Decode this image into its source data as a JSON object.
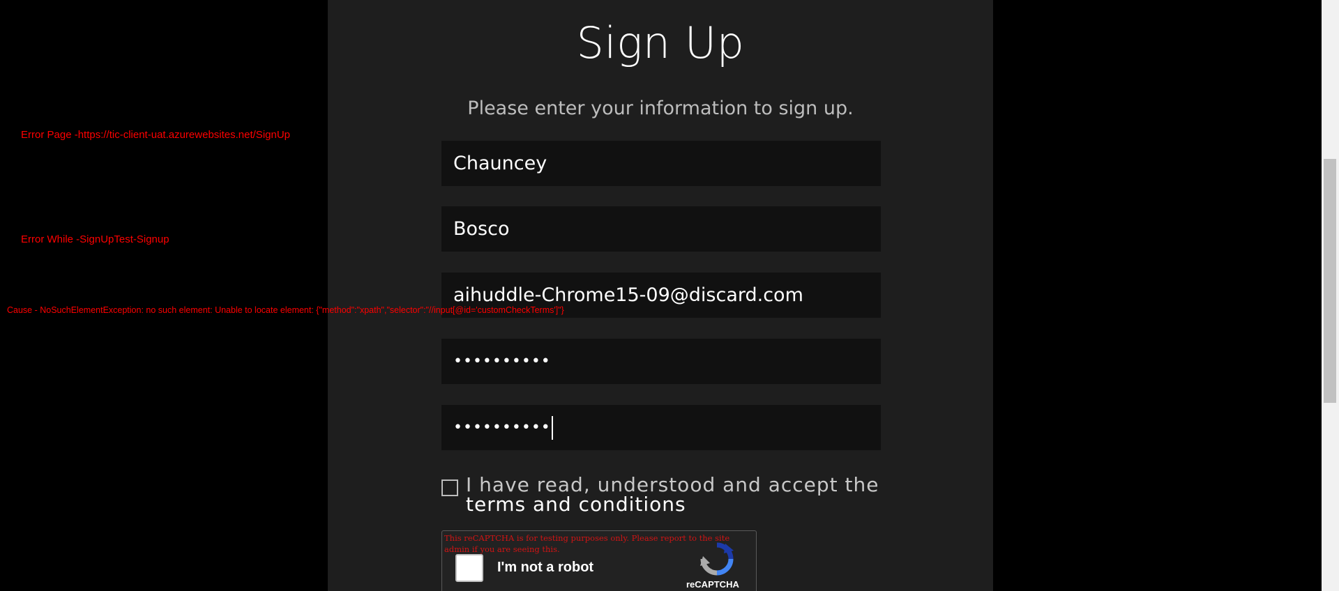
{
  "form": {
    "title": "Sign Up",
    "subtitle": "Please enter your information to sign up.",
    "first_name_value": "Chauncey",
    "last_name_value": "Bosco",
    "email_value": "aihuddle-Chrome15-09@discard.com",
    "password_value": "••••••••••",
    "confirm_password_value": "••••••••••",
    "terms_text": "I have read, understood and accept the",
    "terms_link": "terms and conditions"
  },
  "recaptcha": {
    "warning": "This reCAPTCHA is for testing purposes only. Please report to the site admin if you are seeing this.",
    "label": "I'm not a robot",
    "brand": "reCAPTCHA"
  },
  "errors": {
    "page": "Error Page -https://tic-client-uat.azurewebsites.net/SignUp",
    "while": "Error While -SignUpTest-Signup",
    "cause": "Cause - NoSuchElementException: no such element: Unable to locate element: {\"method\":\"xpath\",\"selector\":\"//input[@id='customCheckTerms']\"}"
  },
  "colors": {
    "error_text": "#ff0000",
    "panel_bg": "#1e1e1e",
    "field_bg": "#111111"
  }
}
